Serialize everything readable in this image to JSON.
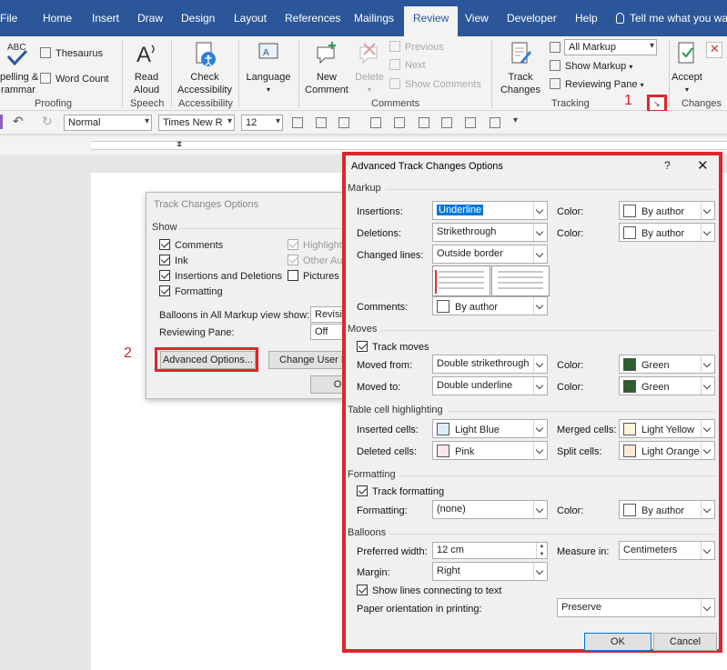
{
  "ribbon_tabs": [
    "File",
    "Home",
    "Insert",
    "Draw",
    "Design",
    "Layout",
    "References",
    "Mailings",
    "Review",
    "View",
    "Developer",
    "Help"
  ],
  "active_tab": "Review",
  "tell_me": "Tell me what you wa",
  "ribbon": {
    "spelling_line1": "pelling &",
    "spelling_line2": "rammar",
    "thesaurus": "Thesaurus",
    "word_count": "Word Count",
    "proofing_label": "Proofing",
    "read_aloud_1": "Read",
    "read_aloud_2": "Aloud",
    "speech_label": "Speech",
    "check_acc_1": "Check",
    "check_acc_2": "Accessibility",
    "accessibility_label": "Accessibility",
    "language": "Language",
    "language_label": "Language",
    "new_comment_1": "New",
    "new_comment_2": "Comment",
    "delete": "Delete",
    "previous": "Previous",
    "next": "Next",
    "show_comments": "Show Comments",
    "comments_label": "Comments",
    "track_changes_1": "Track",
    "track_changes_2": "Changes",
    "all_markup": "All Markup",
    "show_markup": "Show Markup",
    "reviewing_pane": "Reviewing Pane",
    "tracking_label": "Tracking",
    "accept": "Accept",
    "changes_label": "Changes",
    "marker_1": "1"
  },
  "qat": {
    "style": "Normal",
    "font": "Times New R",
    "size": "12"
  },
  "tco": {
    "title": "Track Changes Options",
    "show_label": "Show",
    "comments": "Comments",
    "ink": "Ink",
    "ins_del": "Insertions and Deletions",
    "formatting": "Formatting",
    "highlight": "Highlight",
    "other_authors": "Other Au",
    "pictures": "Pictures E",
    "balloons_label": "Balloons in All Markup view show:",
    "balloons_value": "Revisio",
    "pane_label": "Reviewing Pane:",
    "pane_value": "Off",
    "advanced_btn": "Advanced Options...",
    "change_user_btn": "Change User Na",
    "ok_partial": "O",
    "marker_2": "2"
  },
  "adv": {
    "title": "Advanced Track Changes Options",
    "help": "?",
    "close": "✕",
    "markup": {
      "section": "Markup",
      "insertions_label": "Insertions:",
      "insertions_value": "Underline",
      "insertions_color": "By author",
      "deletions_label": "Deletions:",
      "deletions_value": "Strikethrough",
      "deletions_color": "By author",
      "changed_label": "Changed lines:",
      "changed_value": "Outside border",
      "comments_label": "Comments:",
      "comments_value": "By author",
      "color_label": "Color:"
    },
    "moves": {
      "section": "Moves",
      "track_moves": "Track moves",
      "from_label": "Moved from:",
      "from_value": "Double strikethrough",
      "from_color": "Green",
      "to_label": "Moved to:",
      "to_value": "Double underline",
      "to_color": "Green"
    },
    "table": {
      "section": "Table cell highlighting",
      "inserted_label": "Inserted cells:",
      "inserted_value": "Light Blue",
      "deleted_label": "Deleted cells:",
      "deleted_value": "Pink",
      "merged_label": "Merged cells:",
      "merged_value": "Light Yellow",
      "split_label": "Split cells:",
      "split_value": "Light Orange"
    },
    "formatting": {
      "section": "Formatting",
      "track_formatting": "Track formatting",
      "fmt_label": "Formatting:",
      "fmt_value": "(none)",
      "fmt_color": "By author"
    },
    "balloons": {
      "section": "Balloons",
      "width_label": "Preferred width:",
      "width_value": "12 cm",
      "measure_label": "Measure in:",
      "measure_value": "Centimeters",
      "margin_label": "Margin:",
      "margin_value": "Right",
      "show_lines": "Show lines connecting to text",
      "orientation_label": "Paper orientation in printing:",
      "orientation_value": "Preserve"
    },
    "ok": "OK",
    "cancel": "Cancel"
  },
  "colors": {
    "ribbon_blue": "#2b579a",
    "highlight_red": "#e0242c",
    "green": "#2f5e2f",
    "light_blue": "#dbeef8",
    "pink": "#fde4ee",
    "light_yellow": "#fff3d9",
    "light_orange": "#fde9d4"
  }
}
